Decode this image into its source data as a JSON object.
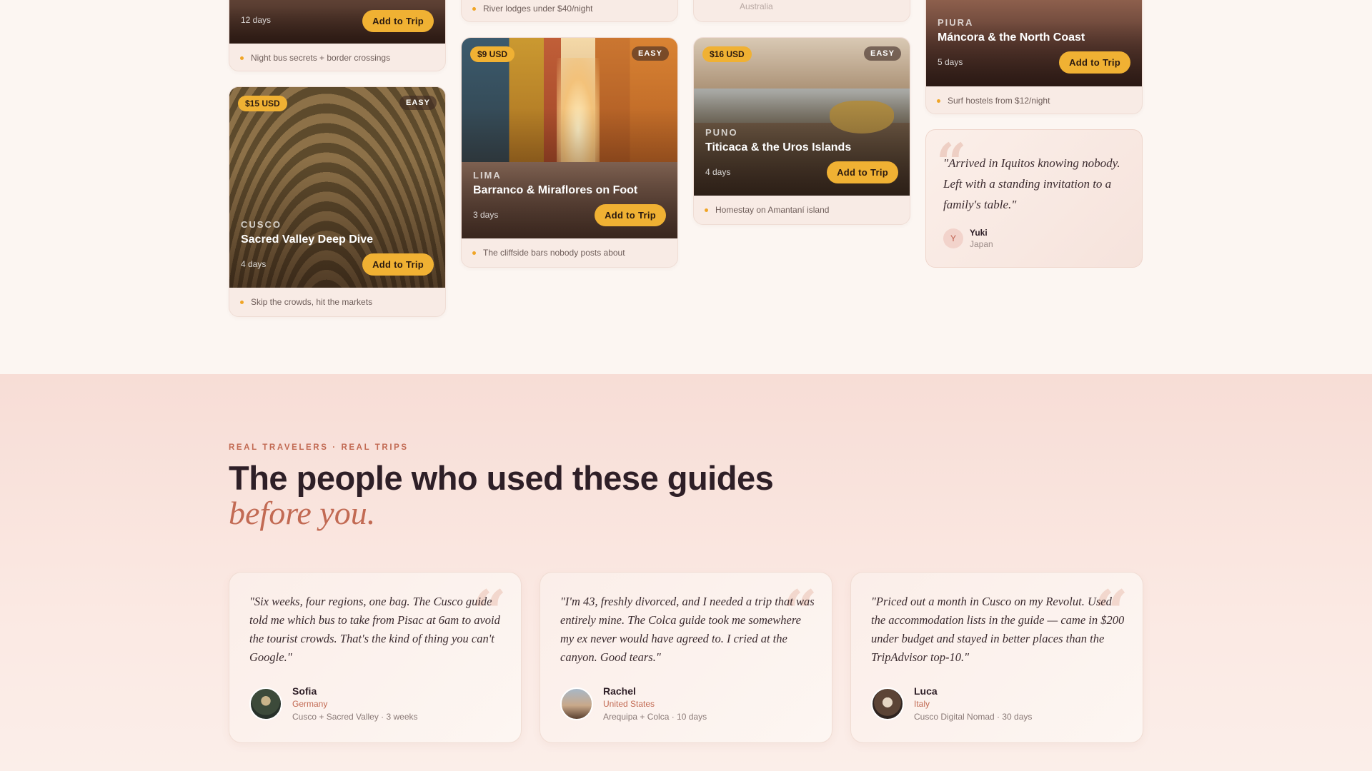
{
  "guides": [
    {
      "region": "",
      "title": "",
      "days": "12 days",
      "price": "",
      "difficulty": "",
      "cta": "Add to Trip",
      "note": "Night bus secrets + border crossings"
    },
    {
      "region": "CUSCO",
      "title": "Sacred Valley Deep Dive",
      "days": "4 days",
      "price": "$15 USD",
      "difficulty": "EASY",
      "cta": "Add to Trip",
      "note": "Skip the crowds, hit the markets"
    },
    {
      "note": "River lodges under $40/night"
    },
    {
      "region": "LIMA",
      "title": "Barranco & Miraflores on Foot",
      "days": "3 days",
      "price": "$9 USD",
      "difficulty": "EASY",
      "cta": "Add to Trip",
      "note": "The cliffside bars nobody posts about"
    },
    {
      "note": "Australia"
    },
    {
      "region": "PUNO",
      "title": "Titicaca & the Uros Islands",
      "days": "4 days",
      "price": "$16 USD",
      "difficulty": "EASY",
      "cta": "Add to Trip",
      "note": "Homestay on Amantaní island"
    },
    {
      "region": "PIURA",
      "title": "Máncora & the North Coast",
      "days": "5 days",
      "price": "",
      "difficulty": "",
      "cta": "Add to Trip",
      "note": "Surf hostels from $12/night"
    }
  ],
  "side_quote": {
    "text": "\"Arrived in Iquitos knowing nobody. Left with a standing invitation to a family's table.\"",
    "initial": "Y",
    "name": "Yuki",
    "country": "Japan"
  },
  "reviews_section": {
    "eyebrow": "REAL TRAVELERS · REAL TRIPS",
    "headline": "The people who used these guides",
    "headline_accent": "before you.",
    "quote_mark": "“",
    "cards": [
      {
        "text": "\"Six weeks, four regions, one bag. The Cusco guide told me which bus to take from Pisac at 6am to avoid the tourist crowds. That's the kind of thing you can't Google.\"",
        "name": "Sofia",
        "country": "Germany",
        "trip": "Cusco + Sacred Valley · 3 weeks"
      },
      {
        "text": "\"I'm 43, freshly divorced, and I needed a trip that was entirely mine. The Colca guide took me somewhere my ex never would have agreed to. I cried at the canyon. Good tears.\"",
        "name": "Rachel",
        "country": "United States",
        "trip": "Arequipa + Colca · 10 days"
      },
      {
        "text": "\"Priced out a month in Cusco on my Revolut. Used the accommodation lists in the guide — came in $200 under budget and stayed in better places than the TripAdvisor top-10.\"",
        "name": "Luca",
        "country": "Italy",
        "trip": "Cusco Digital Nomad · 30 days"
      }
    ]
  },
  "colors": {
    "accent": "#f0b133",
    "terracotta": "#c26a53",
    "ink": "#2e1f27"
  }
}
